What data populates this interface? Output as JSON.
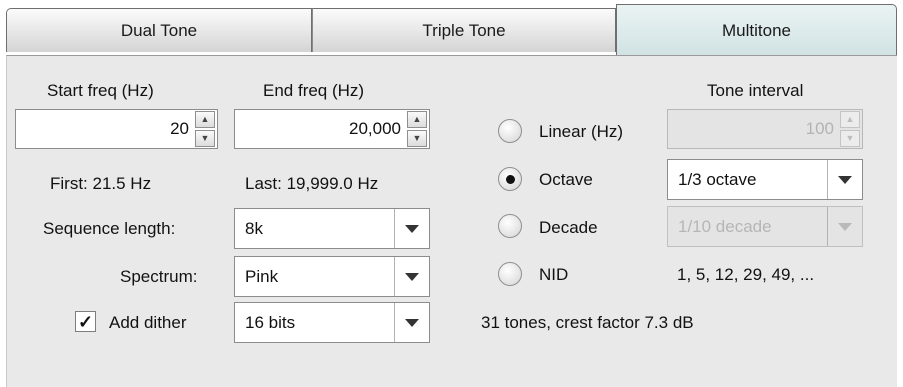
{
  "tabs": [
    "Dual Tone",
    "Triple Tone",
    "Multitone"
  ],
  "start_freq": {
    "label": "Start freq (Hz)",
    "value": "20"
  },
  "end_freq": {
    "label": "End freq (Hz)",
    "value": "20,000"
  },
  "first_text": "First: 21.5 Hz",
  "last_text": "Last: 19,999.0 Hz",
  "sequence_length": {
    "label": "Sequence length:",
    "value": "8k"
  },
  "spectrum": {
    "label": "Spectrum:",
    "value": "Pink"
  },
  "dither": {
    "label": "Add dither",
    "checked": true,
    "check_mark": "✓",
    "value": "16 bits"
  },
  "tone_interval": {
    "header": "Tone interval",
    "linear": {
      "label": "Linear (Hz)",
      "value": "100"
    },
    "octave": {
      "label": "Octave",
      "value": "1/3 octave"
    },
    "decade": {
      "label": "Decade",
      "value": "1/10 decade"
    },
    "nid": {
      "label": "NID",
      "values_text": "1, 5, 12, 29, 49, ..."
    },
    "selected": "octave"
  },
  "summary": "31 tones, crest factor 7.3 dB",
  "icons": {
    "spin_up": "▲",
    "spin_down": "▼"
  },
  "colors": {
    "active_tab": "#dbe9ea",
    "panel": "#e9e9e9"
  }
}
